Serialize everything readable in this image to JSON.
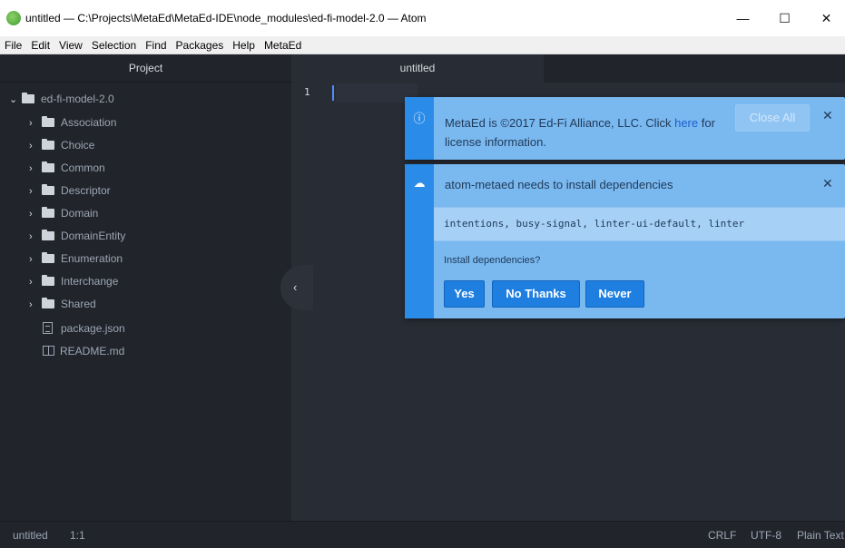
{
  "window": {
    "title": "untitled — C:\\Projects\\MetaEd\\MetaEd-IDE\\node_modules\\ed-fi-model-2.0 — Atom",
    "controls": {
      "minimize": "—",
      "maximize": "☐",
      "close": "✕"
    }
  },
  "menu": [
    "File",
    "Edit",
    "View",
    "Selection",
    "Find",
    "Packages",
    "Help",
    "MetaEd"
  ],
  "tree": {
    "header": "Project",
    "root": "ed-fi-model-2.0",
    "folders": [
      "Association",
      "Choice",
      "Common",
      "Descriptor",
      "Domain",
      "DomainEntity",
      "Enumeration",
      "Interchange",
      "Shared"
    ],
    "files": [
      "package.json",
      "README.md"
    ]
  },
  "tabs": [
    "untitled"
  ],
  "editor": {
    "line_number": "1"
  },
  "notifications": {
    "license": {
      "text_before": "MetaEd is ©2017 Ed-Fi Alliance, LLC. Click",
      "link": "here",
      "text_after": "for license information.",
      "close_all": "Close All",
      "close": "✕"
    },
    "deps": {
      "title": "atom-metaed needs to install dependencies",
      "list": "intentions, busy-signal, linter-ui-default, linter",
      "prompt": "Install dependencies?",
      "buttons": {
        "yes": "Yes",
        "no": "No Thanks",
        "never": "Never"
      },
      "close": "✕"
    }
  },
  "status": {
    "file": "untitled",
    "cursor": "1:1",
    "line_ending": "CRLF",
    "encoding": "UTF-8",
    "grammar": "Plain Text"
  },
  "colors": {
    "accent": "#2a8ce8",
    "notification_bg": "#7ab8f0",
    "editor_bg": "#282c34",
    "panel_bg": "#21252b"
  }
}
